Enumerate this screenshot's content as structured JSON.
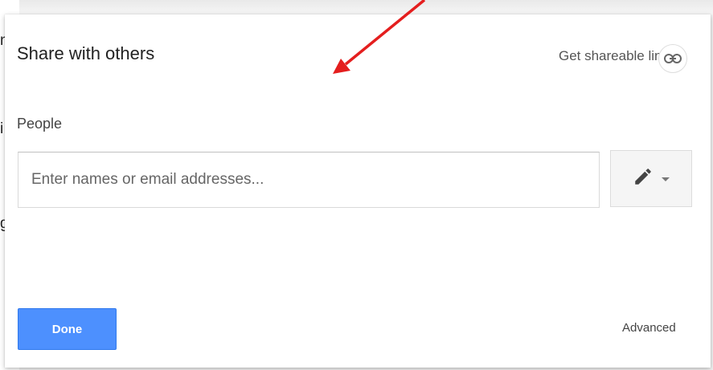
{
  "dialog": {
    "title": "Share with others",
    "share_link_label": "Get shareable link",
    "people_label": "People",
    "people_input": {
      "placeholder": "Enter names or email addresses...",
      "value": ""
    },
    "done_label": "Done",
    "advanced_label": "Advanced"
  },
  "background_fragments": [
    "n",
    "i",
    "g"
  ],
  "icons": {
    "link": "link-icon",
    "pencil": "pencil-icon",
    "dropdown": "chevron-down-icon"
  },
  "colors": {
    "done_button": "#4d90fe",
    "annotation_arrow": "#e41e1e"
  }
}
